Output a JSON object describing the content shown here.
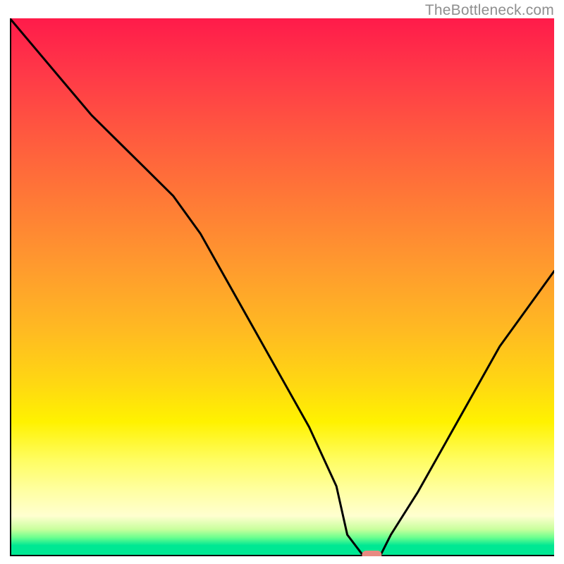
{
  "watermark": {
    "text": "TheBottleneck.com"
  },
  "chart_data": {
    "type": "line",
    "title": "",
    "xlabel": "",
    "ylabel": "",
    "xlim": [
      0,
      100
    ],
    "ylim": [
      0,
      100
    ],
    "x": [
      0,
      5,
      10,
      15,
      20,
      25,
      30,
      35,
      40,
      45,
      50,
      55,
      60,
      62,
      65,
      68,
      70,
      75,
      80,
      85,
      90,
      95,
      100
    ],
    "y": [
      100,
      94,
      88,
      82,
      77,
      72,
      67,
      60,
      51,
      42,
      33,
      24,
      13,
      4,
      0,
      0,
      4,
      12,
      21,
      30,
      39,
      46,
      53
    ],
    "minimum_marker": {
      "x": 66.5,
      "y": 0
    },
    "gradient_stops": [
      {
        "pos": 0.0,
        "color": "#ff1b4a"
      },
      {
        "pos": 0.34,
        "color": "#ff7a36"
      },
      {
        "pos": 0.68,
        "color": "#ffd812"
      },
      {
        "pos": 0.9,
        "color": "#ffffc0"
      },
      {
        "pos": 0.97,
        "color": "#6dff8f"
      },
      {
        "pos": 1.0,
        "color": "#00e893"
      }
    ]
  }
}
